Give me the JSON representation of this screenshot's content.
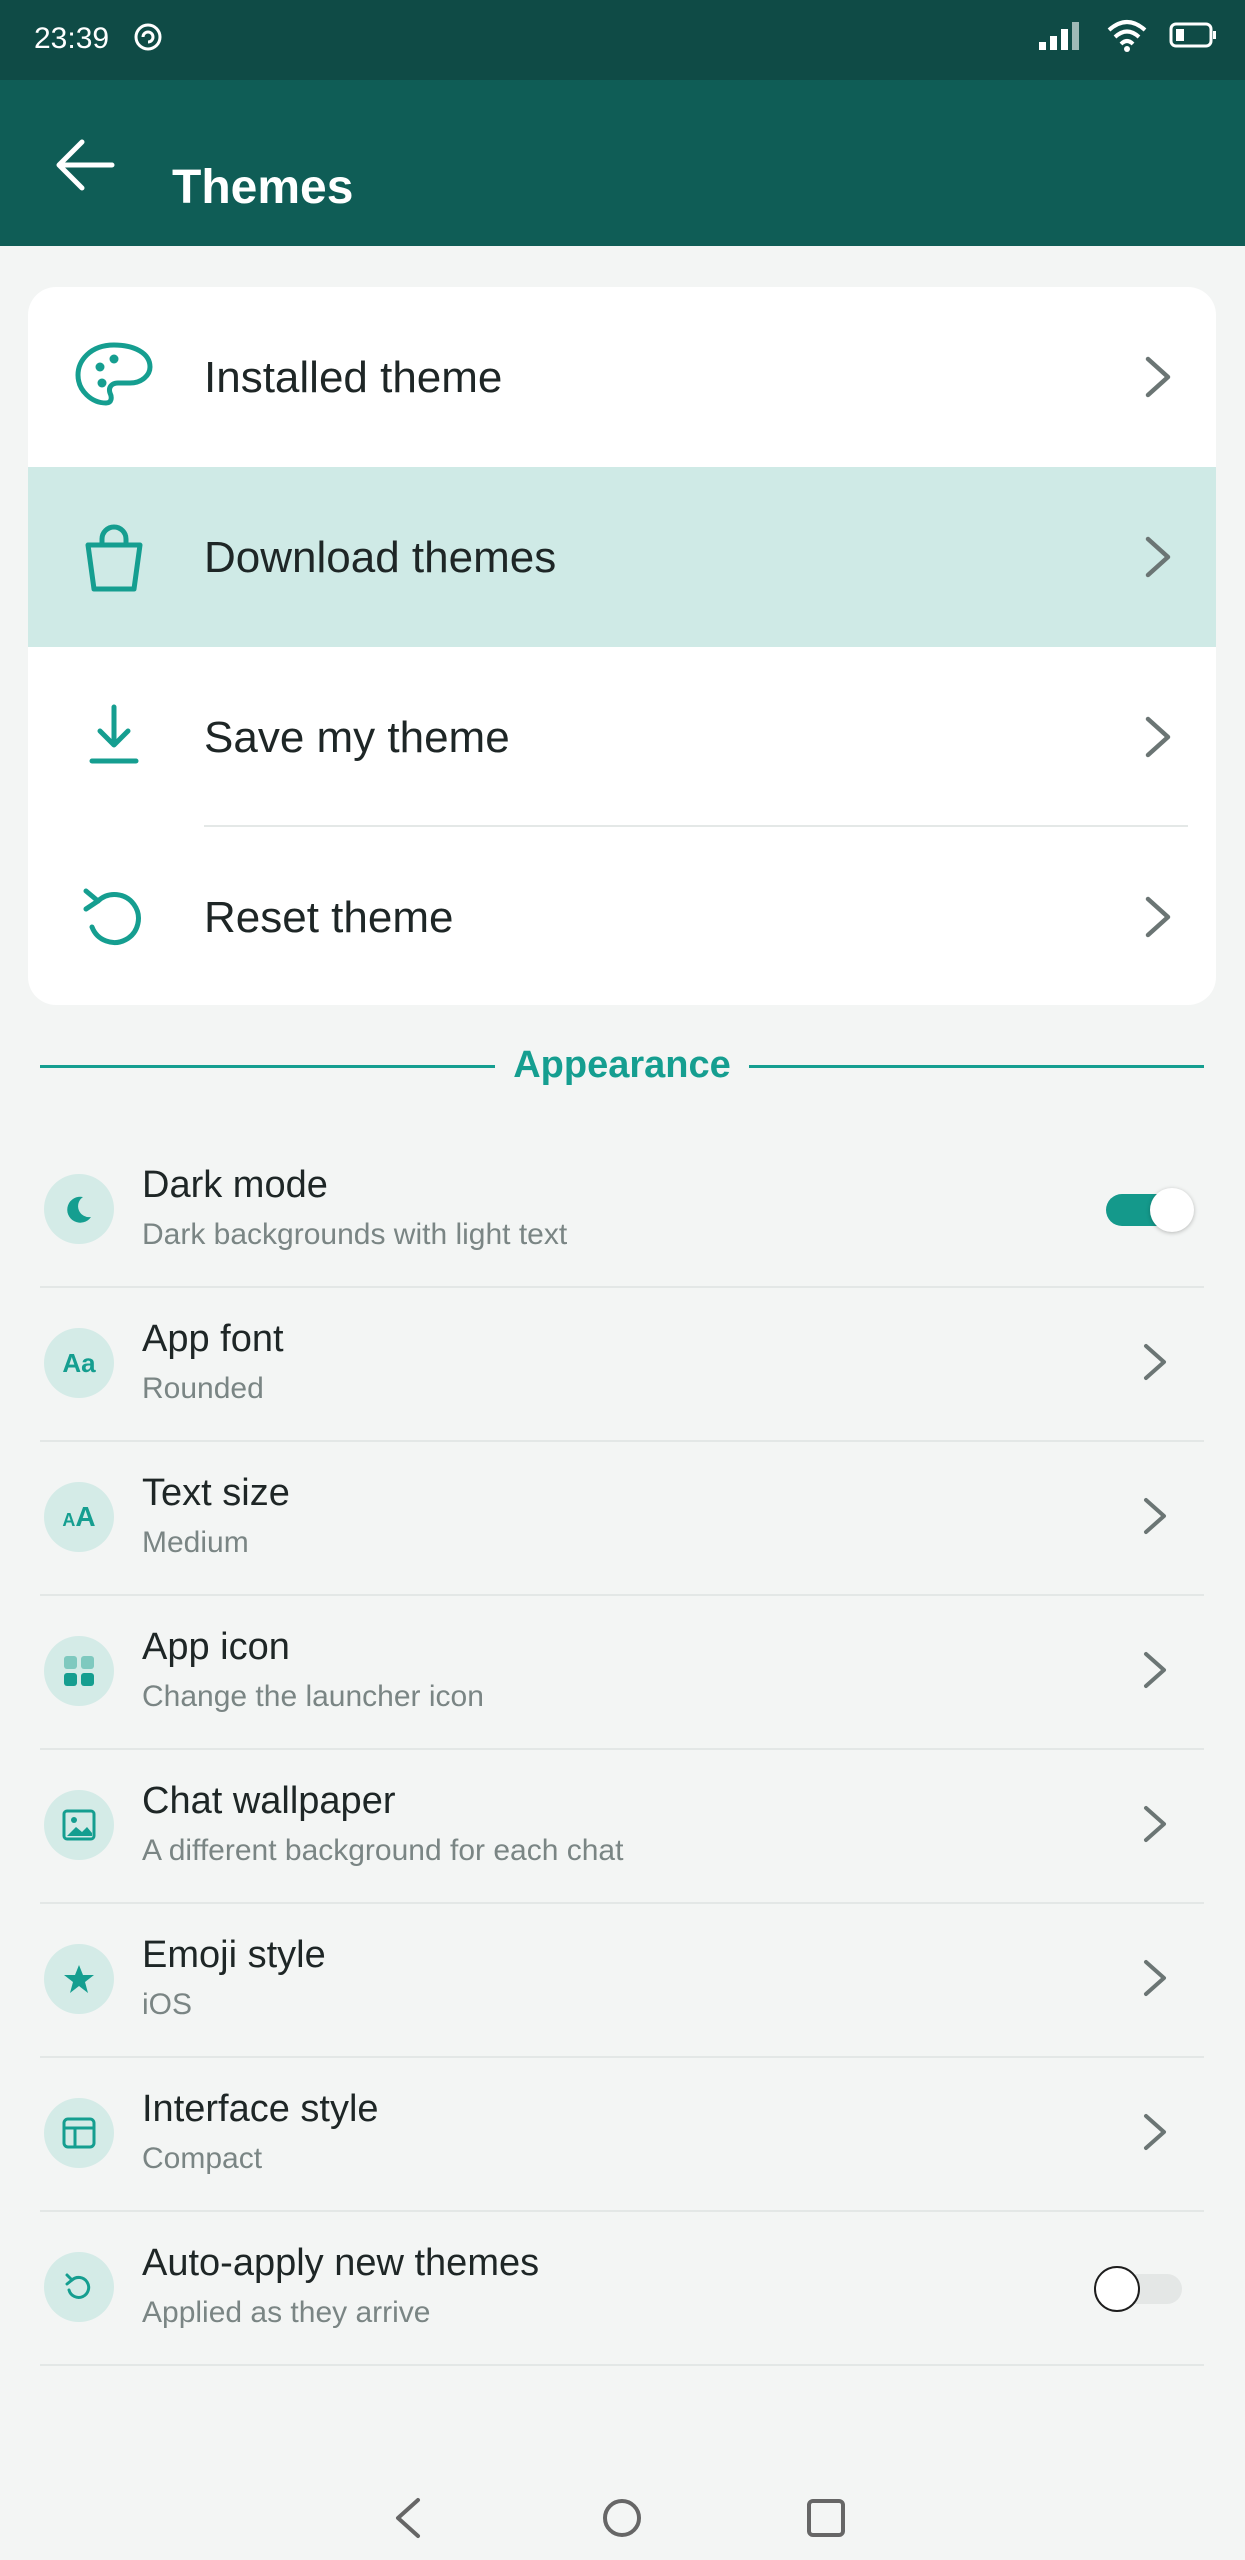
{
  "status": {
    "time": "23:39"
  },
  "header": {
    "title": "Themes"
  },
  "menu": [
    {
      "label": "Installed theme",
      "icon": "palette-icon"
    },
    {
      "label": "Download themes",
      "icon": "shopping-bag-icon",
      "highlighted": true
    },
    {
      "label": "Save my theme",
      "icon": "download-icon"
    },
    {
      "label": "Reset theme",
      "icon": "reset-icon"
    }
  ],
  "section": {
    "title": "Appearance"
  },
  "settings": [
    {
      "title": "Dark mode",
      "subtitle": "Dark backgrounds with light text",
      "icon": "moon-icon",
      "control": "toggle",
      "value": true
    },
    {
      "title": "App font",
      "subtitle": "Rounded",
      "icon": "font-icon",
      "control": "chevron"
    },
    {
      "title": "Text size",
      "subtitle": "Medium",
      "icon": "text-size-icon",
      "control": "chevron"
    },
    {
      "title": "App icon",
      "subtitle": "Change the launcher icon",
      "icon": "grid-icon",
      "control": "chevron"
    },
    {
      "title": "Chat wallpaper",
      "subtitle": "A different background for each chat",
      "icon": "image-icon",
      "control": "chevron"
    },
    {
      "title": "Emoji style",
      "subtitle": "iOS",
      "icon": "star-icon",
      "control": "chevron"
    },
    {
      "title": "Interface style",
      "subtitle": "Compact",
      "icon": "layout-icon",
      "control": "chevron"
    },
    {
      "title": "Auto-apply new themes",
      "subtitle": "Applied as they arrive",
      "icon": "refresh-icon",
      "control": "toggle",
      "value": false
    }
  ],
  "icon_glyphs": {
    "font": "Aa",
    "text_size_small": "A",
    "text_size_large": "A"
  },
  "colors": {
    "accent": "#159e90",
    "appbar": "#0f5d56",
    "statusbar": "#0f4b46",
    "highlight": "#cfeae6"
  }
}
